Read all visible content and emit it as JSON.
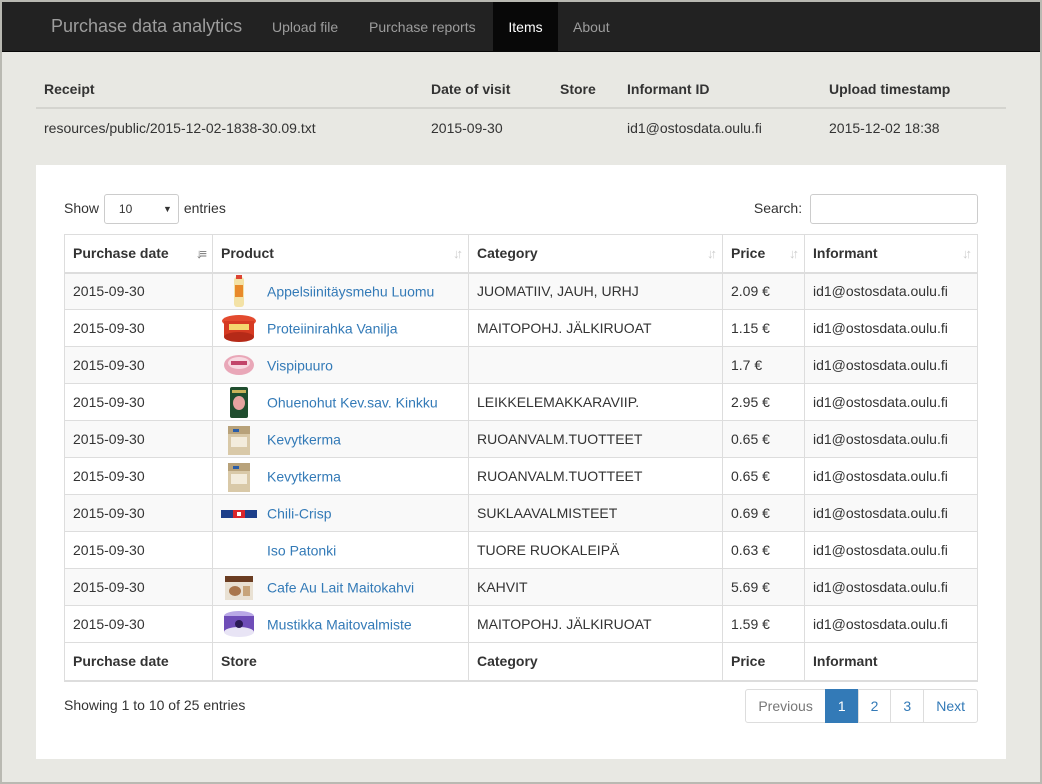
{
  "app": {
    "title": "Purchase data analytics",
    "nav": [
      {
        "label": "Upload file",
        "active": false
      },
      {
        "label": "Purchase reports",
        "active": false
      },
      {
        "label": "Items",
        "active": true
      },
      {
        "label": "About",
        "active": false
      }
    ]
  },
  "receipt": {
    "headers": [
      "Receipt",
      "Date of visit",
      "Store",
      "Informant ID",
      "Upload timestamp"
    ],
    "row": [
      "resources/public/2015-12-02-1838-30.09.txt",
      "2015-09-30",
      "",
      "id1@ostosdata.oulu.fi",
      "2015-12-02 18:38"
    ]
  },
  "controls": {
    "show_label": "Show",
    "entries_value": "10",
    "entries_label": "entries",
    "search_label": "Search:"
  },
  "table": {
    "headers": [
      "Purchase date",
      "Product",
      "Category",
      "Price",
      "Informant"
    ],
    "footers": [
      "Purchase date",
      "Store",
      "Category",
      "Price",
      "Informant"
    ],
    "rows": [
      {
        "date": "2015-09-30",
        "thumb": "juice-bottle-icon",
        "product": "Appelsiinitäysmehu Luomu",
        "category": "JUOMATIIV, JAUH, URHJ",
        "price": "2.09 €",
        "informant": "id1@ostosdata.oulu.fi"
      },
      {
        "date": "2015-09-30",
        "thumb": "quark-tub-icon",
        "product": "Proteiinirahka Vanilja",
        "category": "MAITOPOHJ. JÄLKIRUOAT",
        "price": "1.15 €",
        "informant": "id1@ostosdata.oulu.fi"
      },
      {
        "date": "2015-09-30",
        "thumb": "porridge-tub-icon",
        "product": "Vispipuuro",
        "category": "",
        "price": "1.7 €",
        "informant": "id1@ostosdata.oulu.fi"
      },
      {
        "date": "2015-09-30",
        "thumb": "ham-pack-icon",
        "product": "Ohuenohut Kev.sav. Kinkku",
        "category": "LEIKKELEMAKKARAVIIP.",
        "price": "2.95 €",
        "informant": "id1@ostosdata.oulu.fi"
      },
      {
        "date": "2015-09-30",
        "thumb": "cream-carton-icon",
        "product": "Kevytkerma",
        "category": "RUOANVALM.TUOTTEET",
        "price": "0.65 €",
        "informant": "id1@ostosdata.oulu.fi"
      },
      {
        "date": "2015-09-30",
        "thumb": "cream-carton-icon",
        "product": "Kevytkerma",
        "category": "RUOANVALM.TUOTTEET",
        "price": "0.65 €",
        "informant": "id1@ostosdata.oulu.fi"
      },
      {
        "date": "2015-09-30",
        "thumb": "chocolate-bar-icon",
        "product": "Chili-Crisp",
        "category": "SUKLAAVALMISTEET",
        "price": "0.69 €",
        "informant": "id1@ostosdata.oulu.fi"
      },
      {
        "date": "2015-09-30",
        "thumb": "",
        "product": "Iso Patonki",
        "category": "TUORE RUOKALEIPÄ",
        "price": "0.63 €",
        "informant": "id1@ostosdata.oulu.fi"
      },
      {
        "date": "2015-09-30",
        "thumb": "coffee-box-icon",
        "product": "Cafe Au Lait Maitokahvi",
        "category": "KAHVIT",
        "price": "5.69 €",
        "informant": "id1@ostosdata.oulu.fi"
      },
      {
        "date": "2015-09-30",
        "thumb": "yogurt-cup-icon",
        "product": "Mustikka Maitovalmiste",
        "category": "MAITOPOHJ. JÄLKIRUOAT",
        "price": "1.59 €",
        "informant": "id1@ostosdata.oulu.fi"
      }
    ]
  },
  "footer": {
    "info": "Showing 1 to 10 of 25 entries",
    "pagination": [
      "Previous",
      "1",
      "2",
      "3",
      "Next"
    ]
  },
  "colors": {
    "navbar": "#222222",
    "link": "#337ab7",
    "active_page": "#337ab7",
    "page_background": "#e8e8e3"
  }
}
